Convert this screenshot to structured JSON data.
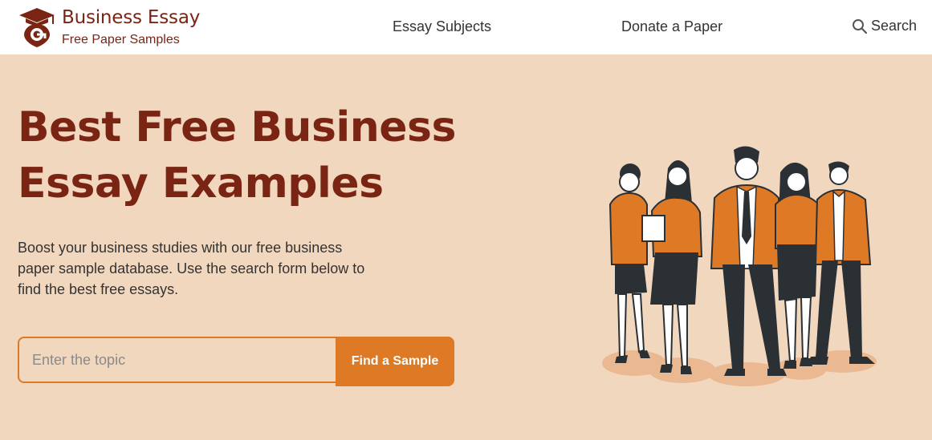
{
  "brand": {
    "title": "Business Essay",
    "subtitle": "Free Paper Samples"
  },
  "nav": {
    "subjects": "Essay Subjects",
    "donate": "Donate a Paper",
    "search": "Search"
  },
  "hero": {
    "title_line1": "Best Free Business",
    "title_line2": "Essay Examples",
    "description": "Boost your business studies with our free business paper sample database. Use the search form below to find the best free essays."
  },
  "search_form": {
    "placeholder": "Enter the topic",
    "button": "Find a Sample"
  },
  "colors": {
    "brand": "#7a2414",
    "accent": "#de7a26",
    "hero_bg": "#f2d7bf",
    "header_bg": "#ffffff"
  },
  "icons": {
    "logo": "graduation-cap-location-icon",
    "search": "magnifier-icon"
  }
}
